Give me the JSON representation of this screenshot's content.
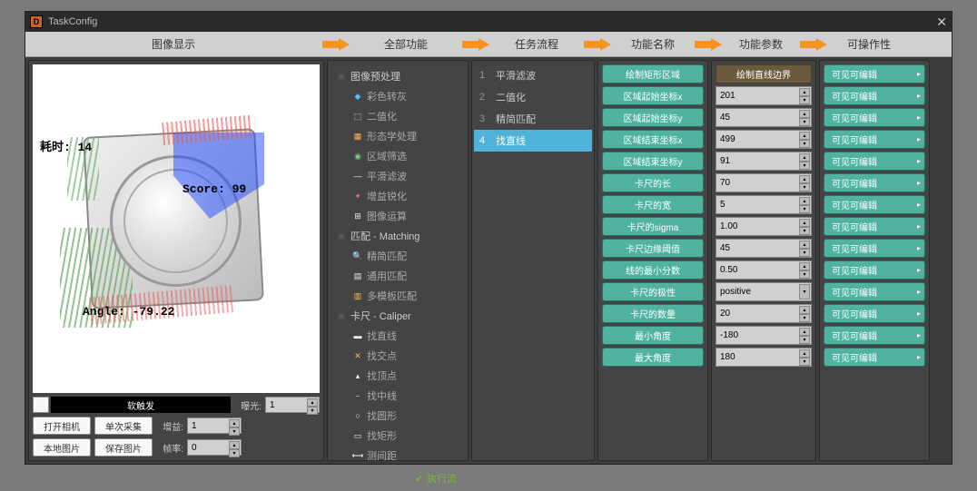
{
  "window": {
    "title": "TaskConfig"
  },
  "headers": {
    "c1": "图像显示",
    "c2": "全部功能",
    "c3": "任务流程",
    "c4": "功能名称",
    "c5": "功能参数",
    "c6": "可操作性"
  },
  "image_overlay": {
    "time_label": "耗时:",
    "time_value": "14",
    "score_label": "Score:",
    "score_value": "99",
    "angle_label": "Angle:",
    "angle_value": "-79.22"
  },
  "left_controls": {
    "soft_trigger": "软触发",
    "expo_label": "曝光:",
    "expo_val": "1",
    "open_cam": "打开相机",
    "single_capture": "单次采集",
    "gain_label": "增益:",
    "gain_val": "1",
    "local_img": "本地图片",
    "save_img": "保存图片",
    "frame_label": "帧率:",
    "frame_val": "0"
  },
  "func_tree": {
    "g1": "图像预处理",
    "g1_items": [
      "彩色转灰",
      "二值化",
      "形态学处理",
      "区域筛选",
      "平滑滤波",
      "增益锐化",
      "图像运算"
    ],
    "g2": "匹配 - Matching",
    "g2_items": [
      "精简匹配",
      "通用匹配",
      "多模板匹配"
    ],
    "g3": "卡尺 - Caliper",
    "g3_items": [
      "找直线",
      "找交点",
      "找顶点",
      "找中线",
      "找圆形",
      "找矩形",
      "测间距"
    ],
    "execute": "执行流"
  },
  "flow": {
    "items": [
      "平滑滤波",
      "二值化",
      "精简匹配",
      "找直线"
    ],
    "selected_index": 3
  },
  "names": {
    "items": [
      "绘制矩形区域",
      "区域起始坐标x",
      "区域起始坐标y",
      "区域结束坐标x",
      "区域结束坐标y",
      "卡尺的长",
      "卡尺的宽",
      "卡尺的sigma",
      "卡尺边缘阈值",
      "线的最小分数",
      "卡尺的极性",
      "卡尺的数量",
      "最小角度",
      "最大角度"
    ]
  },
  "params": {
    "header": "绘制直线边界",
    "items": [
      "201",
      "45",
      "499",
      "91",
      "70",
      "5",
      "1.00",
      "45",
      "0.50",
      "positive",
      "20",
      "-180",
      "180"
    ]
  },
  "ops": {
    "label": "可见可编辑"
  }
}
